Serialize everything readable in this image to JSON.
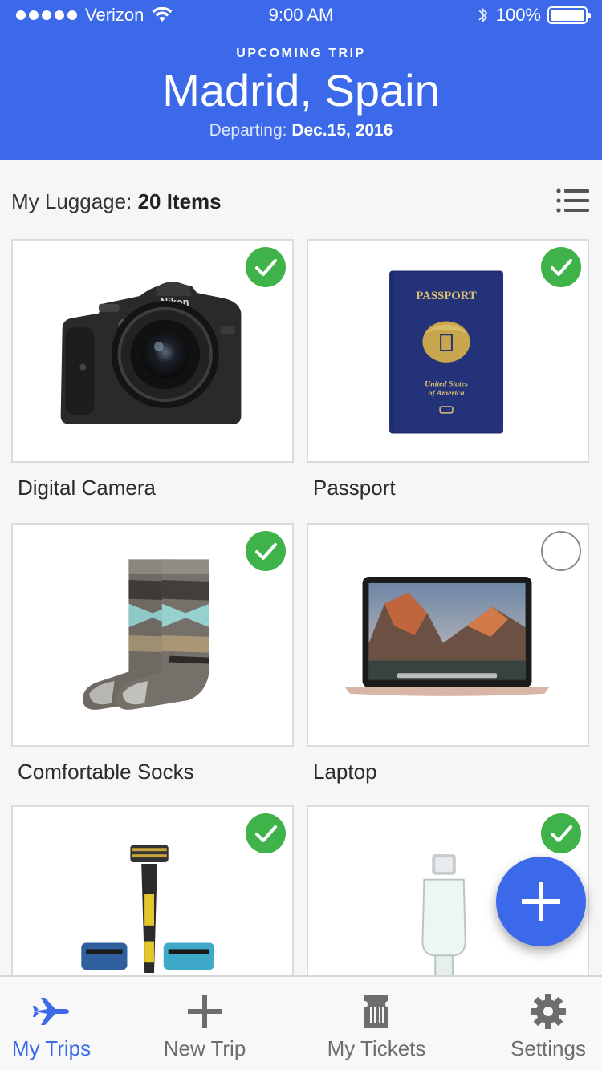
{
  "status_bar": {
    "carrier": "Verizon",
    "time": "9:00 AM",
    "battery": "100%",
    "signal_bars": 5
  },
  "trip": {
    "eyebrow": "UPCOMING TRIP",
    "title": "Madrid, Spain",
    "departing_label": "Departing:",
    "departing_date": "Dec.15, 2016"
  },
  "luggage": {
    "label": "My Luggage:",
    "count": "20 Items"
  },
  "items": [
    {
      "label": "Digital Camera",
      "checked": true,
      "icon": "camera-image"
    },
    {
      "label": "Passport",
      "checked": true,
      "icon": "passport-image"
    },
    {
      "label": "Comfortable Socks",
      "checked": true,
      "icon": "socks-image"
    },
    {
      "label": "Laptop",
      "checked": false,
      "icon": "laptop-image"
    },
    {
      "label": "",
      "checked": true,
      "icon": "razor-image"
    },
    {
      "label": "",
      "checked": true,
      "icon": "charger-cable-image"
    }
  ],
  "passport_text": {
    "heading": "PASSPORT",
    "country_line1": "United States",
    "country_line2": "of America"
  },
  "camera_text": {
    "brand": "Nikon"
  },
  "tabs": [
    {
      "label": "My Trips",
      "icon": "airplane-icon",
      "active": true
    },
    {
      "label": "New Trip",
      "icon": "plus-icon",
      "active": false
    },
    {
      "label": "My Tickets",
      "icon": "ticket-icon",
      "active": false
    },
    {
      "label": "Settings",
      "icon": "gear-icon",
      "active": false
    }
  ],
  "colors": {
    "accent": "#3b69e9",
    "check_green": "#3fb34a",
    "inactive_tab": "#6d6d6d"
  }
}
